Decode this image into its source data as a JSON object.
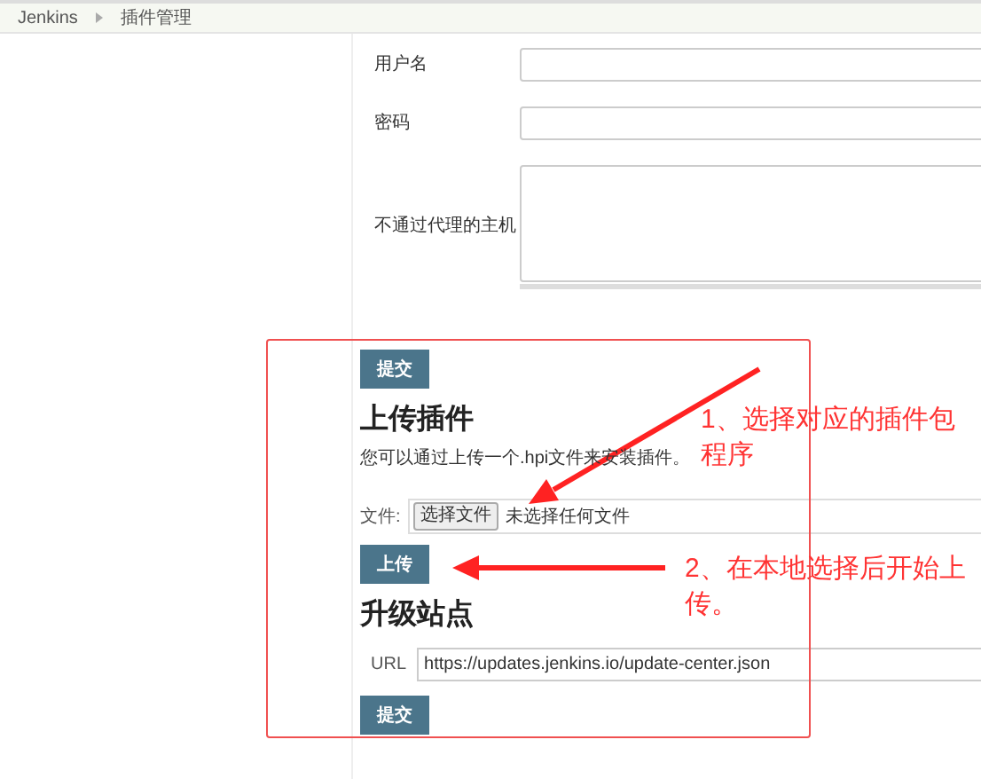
{
  "breadcrumb": [
    {
      "label": "Jenkins"
    },
    {
      "label": "插件管理"
    }
  ],
  "proxy_fields": [
    {
      "label": "用户名",
      "kind": "input"
    },
    {
      "label": "密码",
      "kind": "input"
    },
    {
      "label": "不通过代理的主机",
      "kind": "textarea"
    }
  ],
  "proxy_submit": "提交",
  "upload": {
    "heading": "上传插件",
    "description": "您可以通过上传一个.hpi文件来安装插件。",
    "file_label": "文件:",
    "choose_button": "选择文件",
    "file_status": "未选择任何文件",
    "upload_button": "上传"
  },
  "update_site": {
    "heading": "升级站点",
    "url_label": "URL",
    "url_value": "https://updates.jenkins.io/update-center.json",
    "submit": "提交"
  },
  "annotations": [
    {
      "text": "1、选择对应的插件包程序"
    },
    {
      "text": "2、在本地选择后开始上传。"
    }
  ]
}
